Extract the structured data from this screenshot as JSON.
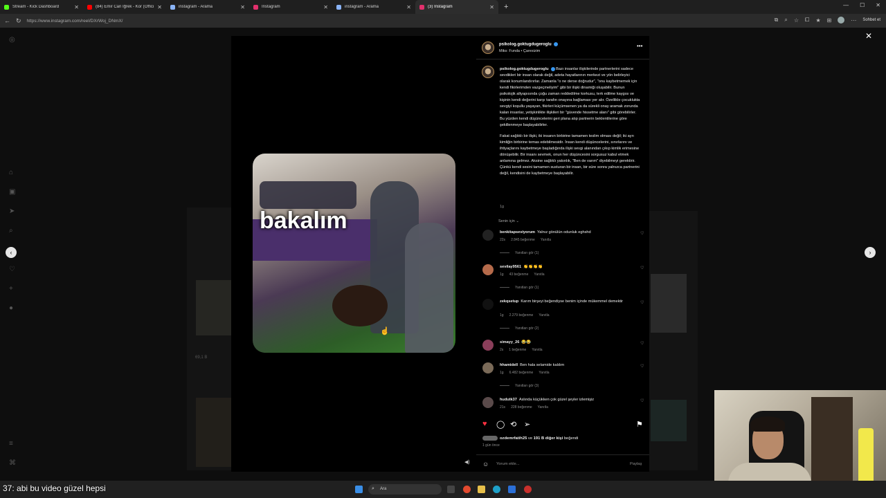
{
  "browser": {
    "tabs": [
      {
        "title": "Stream - Kick Dashboard",
        "icon": "kick-icon",
        "color": "#53fc18"
      },
      {
        "title": "(84) Emir Can İğrek - Kor (Official",
        "icon": "youtube-icon",
        "color": "#ff0000"
      },
      {
        "title": "instagram - Arama",
        "icon": "search-icon",
        "color": "#8ab4f8"
      },
      {
        "title": "Instagram",
        "icon": "instagram-icon",
        "color": "#e1306c"
      },
      {
        "title": "instagram - Arama",
        "icon": "search-icon",
        "color": "#8ab4f8"
      },
      {
        "title": "(3) Instagram",
        "icon": "instagram-icon",
        "color": "#e1306c"
      }
    ],
    "new_tab": "+",
    "url": "https://www.instagram.com/reel/DXrWoj_DNmX/",
    "sohbet": "Sohbet et"
  },
  "reel": {
    "caption_overlay": "bakalım",
    "ghost_views": "69,1 B"
  },
  "post": {
    "username": "psikolog.goktugdugeroglu",
    "audio": "Miks: Funda • Çaresizim",
    "caption_user": "psikolog.goktugdugeroglu",
    "caption_p1": "Bazı insanlar ilişkilerinde partnerlerini sadece sevdikleri bir insan olarak değil, adeta hayatlarının merkezi ve yön belirleyici olarak konumlandırırlar. Zamanla \"o ne derse doğrudur\", \"onu kaybetmemek için kendi fikirlerimden vazgeçmeliyim\" gibi bir ilişki dinamiği oluşabilir. Bunun psikolojik altyapısında çoğu zaman reddedilme korkusu, terk edilme kaygısı ve kişinin kendi değerini karşı tarafın onayına bağlaması yer alır. Özellikle çocuklukta sevgiyi koşullu yaşayan, fikirleri küçümsenen ya da sürekli onay aramak zorunda kalan insanlar, yetişkinlikte ilişkileri bir \"güvende hissetme alanı\" gibi görebilirler. Bu yüzden kendi düşüncelerini geri plana atıp partnerin beklentilerine göre şekillenmeye başlayabilirler.",
    "caption_p2": "Fakat sağlıklı bir ilişki, iki insanın birbirine tamamen teslim olması değil; iki ayrı kimliğin birbirine temas edebilmesidir. İnsan kendi düşüncelerini, sınırlarını ve ihtiyaçlarını kaybetmeye başladığında ilişki sevgi alanından çıkıp kimlik erimesine dönüşebilir. Bir insanı sevmek, onun her düşüncesini sorgusuz kabul etmek anlamına gelmez. Aksine sağlıklı yakınlık, \"Ben de varım\" diyebilmeyi gerektirir. Çünkü kendi sesini tamamen susturan bir insan, bir süre sonra yalnızca partnerini değil, kendisini de kaybetmeye başlayabilir.",
    "caption_time": "1g",
    "for_you": "Senin için",
    "comments": [
      {
        "user": "benkitapseviyorum",
        "text": "Yalnız gönülün odunluk eghshd",
        "time": "22s",
        "likes": "2.845 beğenme",
        "reply": "Yanıtla",
        "replies": "Yanıtları gör (1)"
      },
      {
        "user": "sevilay9561",
        "text": "👏👏👏👏",
        "time": "1g",
        "likes": "43 beğenme",
        "reply": "Yanıtla",
        "replies": "Yanıtları gör (1)"
      },
      {
        "user": "zekqsetup",
        "text": "Karım birşeyi beğendiyse benim içinde mükemmel demektir",
        "time": "1g",
        "likes": "2.279 beğenme",
        "reply": "Yanıtla",
        "replies": "Yanıtları gör (2)"
      },
      {
        "user": "simayy_26",
        "text": "😂😂",
        "time": "2s",
        "likes": "1 beğenme",
        "reply": "Yanıtla",
        "replies": ""
      },
      {
        "user": "hhamidell",
        "text": "Ben hala selamide kaldım",
        "time": "1g",
        "likes": "6.482 beğenme",
        "reply": "Yanıtla",
        "replies": "Yanıtları gör (3)"
      },
      {
        "user": "hudutk37",
        "text": "Aslında küçükken çok güzel şeyler izlemişiz",
        "time": "21s",
        "likes": "228 beğenme",
        "reply": "Yanıtla",
        "replies": ""
      }
    ],
    "liked_by_user": "ozdemrfatih25",
    "liked_by_mid": " ve ",
    "liked_by_count": "191 B diğer kişi",
    "liked_by_end": " beğendi",
    "ago": "1 gün önce",
    "comment_placeholder": "Yorum ekle...",
    "share": "Paylaş"
  },
  "taskbar": {
    "overlay_text": "37: abi bu video güzel hepsi",
    "search": "Ara"
  }
}
